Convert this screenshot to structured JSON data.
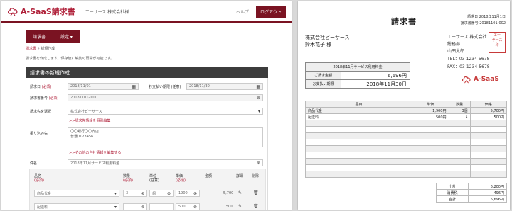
{
  "app": {
    "logo_text": "A-SaaS請求書",
    "company": "エーサース 株式会社様",
    "help": "ヘルプ",
    "logout": "ログアウト",
    "nav": [
      "請求書",
      "設定 ▾"
    ],
    "breadcrumb": {
      "link": "請求書",
      "sep": " » ",
      "current": "新規作成"
    },
    "intro": "請求書を作成します。保存後に編集の再開が可能です。",
    "section_title": "請求書の新規作成",
    "labels": {
      "issue_date": "請求日",
      "due_date": "お支払い期限",
      "optional": "(任意)",
      "number": "請求書番号",
      "client": "請求先を選択",
      "bank": "振り込み先",
      "subject": "件名",
      "required": "(必須)"
    },
    "fields": {
      "issue_date": "2018/11/01",
      "due_date": "2018/11/30",
      "number": "20181101-001",
      "client": "株式会社ビーサース",
      "bank_lines": [
        "〇〇銀行〇〇支店",
        "普通0123456"
      ],
      "subject": "2018年11月サービス利用料金"
    },
    "links": {
      "client_edit": ">>請求先情報を個別編集",
      "other_edit": ">>その他の自社情報を編集する"
    },
    "line_headers": {
      "item": "品名",
      "qty": "数量",
      "unit": "単位",
      "price": "単価",
      "amount": "金額",
      "detail": "詳細",
      "delete": "削除",
      "req": "(必須)",
      "opt": "(任意)"
    },
    "lines": [
      {
        "item": "商品代金",
        "qty": "3",
        "unit": "個",
        "price": "1900",
        "amount": "5,700"
      },
      {
        "item": "配送料",
        "qty": "1",
        "unit": "",
        "price": "500",
        "amount": "500"
      }
    ]
  },
  "invoice": {
    "title": "請求書",
    "date_label": "請求日",
    "date": "2018年11月1日",
    "number_label": "請求書番号",
    "number": "20181101-002",
    "client_name": "株式会社ビーサース",
    "contact": "鈴木花子 様",
    "issuer": [
      "エーサース 株式会社",
      "総務部",
      "山田太郎",
      "TEL：03-1234-5678",
      "FAX：03-1234-5678"
    ],
    "stamp": [
      "エー",
      "サース",
      "印"
    ],
    "brand": "A-SaaS",
    "summary_title": "2018年11月サービス利用料金",
    "amount_label": "ご請求金額",
    "amount": "6,696円",
    "due_label": "お支払い期限",
    "due": "2018年11月30日",
    "headers": [
      "品目",
      "単価",
      "数量",
      "価格"
    ],
    "rows": [
      [
        "商品代金",
        "1,900円",
        "3個",
        "5,700円"
      ],
      [
        "配送料",
        "500円",
        "1",
        "500円"
      ]
    ],
    "totals": [
      {
        "label": "小計",
        "value": "6,200円"
      },
      {
        "label": "消費税",
        "value": "496円"
      },
      {
        "label": "合計",
        "value": "6,696円"
      }
    ]
  }
}
